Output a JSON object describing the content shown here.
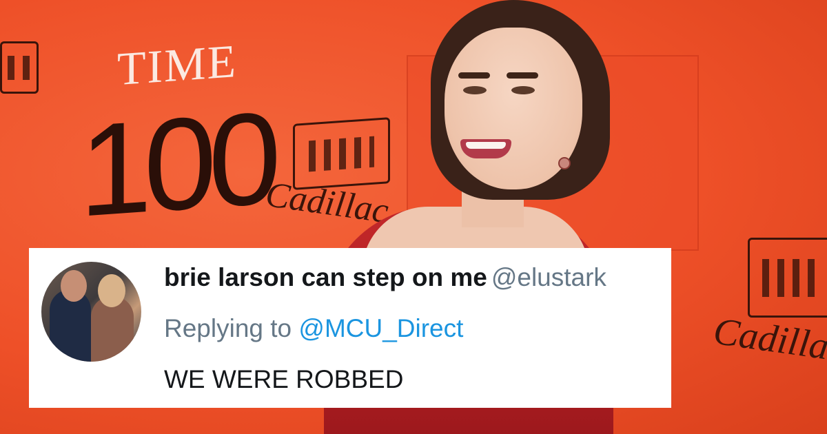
{
  "background": {
    "backdrop_color": "#f0542e",
    "time_logo": "TIME",
    "time_number": "100",
    "sponsor_script_left": "Cadillac",
    "sponsor_script_right": "Cadilla",
    "crest_icon": "cadillac-crest-icon"
  },
  "tweet": {
    "avatar_icon": "user-avatar-photo",
    "display_name": "brie larson can step on me",
    "handle": "@elustark",
    "replying_prefix": "Replying to",
    "replying_handle": "@MCU_Direct",
    "text": "WE WERE ROBBED",
    "colors": {
      "name": "#14171a",
      "secondary": "#657786",
      "link": "#1b95e0",
      "card": "#ffffff"
    }
  }
}
